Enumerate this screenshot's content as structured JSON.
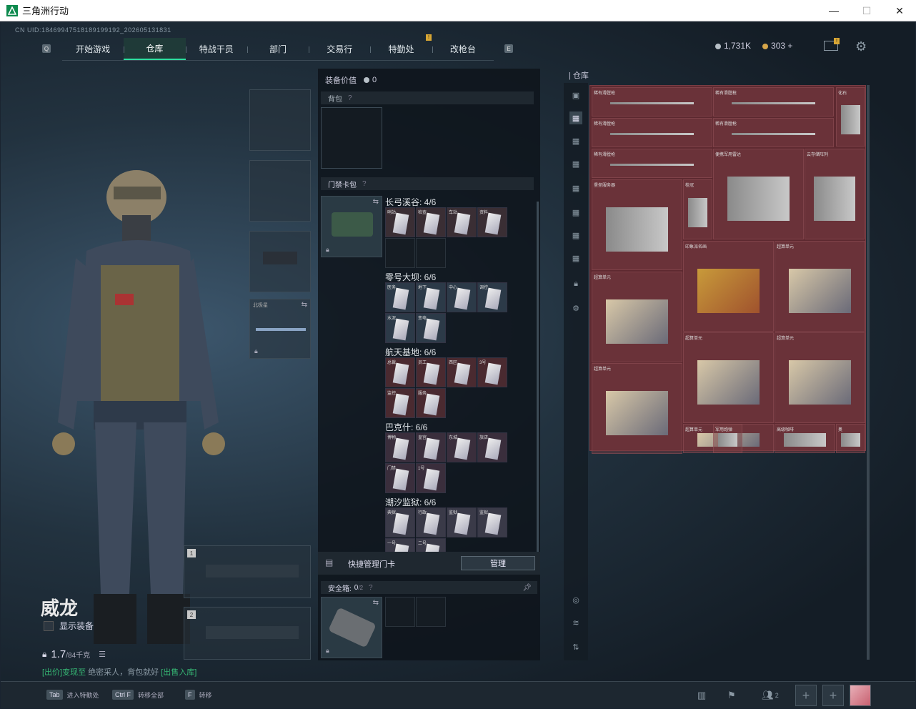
{
  "window": {
    "title": "三角洲行动",
    "controls": {
      "minimize": "—",
      "maximize": "☐",
      "close": "✕"
    }
  },
  "uid": "CN UID:18469947518189199192_2026051318​31",
  "nav": {
    "left_key": "Q",
    "right_key": "E",
    "tabs": [
      "开始游戏",
      "仓库",
      "特战干员",
      "部门",
      "交易行",
      "特勤处",
      "改枪台"
    ],
    "active": "仓库",
    "badge_tab": "特勤处",
    "badge": "!"
  },
  "currency": {
    "silver": "1,731K",
    "gold": "303",
    "plus": "+",
    "mail_badge": "!"
  },
  "operator": {
    "name": "威龙",
    "show_gear": "显示装备",
    "weight": "1.7",
    "weight_max": "/84千克",
    "hint_a": "[出价]变现至",
    "hint_b": "绝密采人，背包就好",
    "hint_c": "[出售入库]"
  },
  "gear": {
    "slot4_label": "北极星",
    "weapon_slots": [
      "1",
      "2"
    ]
  },
  "equipment": {
    "value_label": "装备价值",
    "value": "0",
    "backpack_label": "背包",
    "keycard_label": "门禁卡包",
    "help": "?",
    "manage_quick": "快捷管理门卡",
    "manage_btn": "管理",
    "safe_label": "安全箱:",
    "safe_value": "0",
    "safe_max": "/2"
  },
  "keycard_groups": [
    {
      "title": "长弓溪谷: 4/6",
      "rows": [
        [
          "哨站",
          "检查",
          "车站",
          "资料"
        ]
      ]
    },
    {
      "title": "零号大坝: 6/6",
      "rows": [
        [
          "医务",
          "地下",
          "中心",
          "调控"
        ],
        [
          "水泥",
          "变电"
        ]
      ]
    },
    {
      "title": "航天基地: 6/6",
      "rows": [
        [
          "总裁",
          "员工",
          "西区",
          "3号"
        ],
        [
          "监控",
          "服务"
        ]
      ]
    },
    {
      "title": "巴克什: 6/6",
      "rows": [
        [
          "博物",
          "皇宫",
          "东城",
          "旅店"
        ],
        [
          "门禁",
          "1号"
        ]
      ]
    },
    {
      "title": "潮汐监狱: 6/6",
      "rows": [
        [
          "典狱",
          "行政",
          "监狱",
          "监狱"
        ],
        [
          "一号",
          "二号"
        ]
      ]
    }
  ],
  "warehouse": {
    "label": "仓库",
    "items": [
      "稀有滑膛枪",
      "稀有滑膛枪",
      "化石",
      "稀有滑膛枪",
      "稀有滑膛枪",
      "稀有滑膛枪",
      "便携军用雷达",
      "云存储阵列",
      "堡垒服务器",
      "桂冠",
      "印象派名画",
      "超算单元",
      "超算单元",
      "超算单元",
      "超算单元",
      "超算单元",
      "超算单元",
      "军用炮弹",
      "高级咖啡",
      "奥"
    ]
  },
  "bottom": {
    "keys": [
      {
        "key": "Tab",
        "label": "进入特勤处"
      },
      {
        "key": "Ctrl F",
        "label": "转移全部"
      },
      {
        "key": "F",
        "label": "转移"
      }
    ],
    "squad_count": "2"
  }
}
